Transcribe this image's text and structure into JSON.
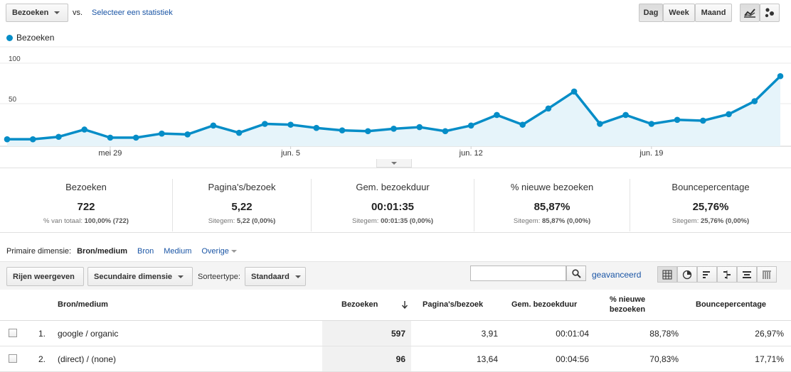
{
  "toolbar": {
    "metric_select": "Bezoeken",
    "vs_label": "vs.",
    "select_statistic": "Selecteer een statistiek",
    "granularity": [
      "Dag",
      "Week",
      "Maand"
    ],
    "active_granularity": "Dag",
    "chart_type_icons": [
      "line-chart-icon",
      "motion-chart-icon"
    ]
  },
  "chart": {
    "legend": "Bezoeken",
    "colors": {
      "line": "#058dc7",
      "fill": "#e6f4fa"
    }
  },
  "chart_data": {
    "type": "area",
    "series": [
      {
        "name": "Bezoeken",
        "values": [
          6,
          6,
          9,
          18,
          8,
          8,
          13,
          12,
          23,
          14,
          25,
          24,
          20,
          17,
          16,
          19,
          21,
          16,
          23,
          36,
          24,
          44,
          65,
          25,
          36,
          25,
          30,
          29,
          37,
          53,
          84
        ]
      }
    ],
    "x_tick_labels": [
      "mei 29",
      "jun. 5",
      "jun. 12",
      "jun. 19"
    ],
    "x_tick_positions": [
      4,
      11,
      18,
      25
    ],
    "y_tick_labels": [
      "100",
      "50"
    ],
    "ylim": [
      0,
      100
    ],
    "grid": true
  },
  "scorecards": [
    {
      "label": "Bezoeken",
      "value": "722",
      "sub_prefix": "% van totaal:",
      "sub_value": "100,00% (722)"
    },
    {
      "label": "Pagina's/bezoek",
      "value": "5,22",
      "sub_prefix": "Sitegem:",
      "sub_value": "5,22 (0,00%)"
    },
    {
      "label": "Gem. bezoekduur",
      "value": "00:01:35",
      "sub_prefix": "Sitegem:",
      "sub_value": "00:01:35 (0,00%)"
    },
    {
      "label": "% nieuwe bezoeken",
      "value": "85,87%",
      "sub_prefix": "Sitegem:",
      "sub_value": "85,87% (0,00%)"
    },
    {
      "label": "Bouncepercentage",
      "value": "25,76%",
      "sub_prefix": "Sitegem:",
      "sub_value": "25,76% (0,00%)"
    }
  ],
  "primary_dimension": {
    "label": "Primaire dimensie:",
    "active": "Bron/medium",
    "options": [
      "Bron",
      "Medium"
    ],
    "other": "Overige"
  },
  "table_toolbar": {
    "show_rows": "Rijen weergeven",
    "secondary_dimension": "Secundaire dimensie",
    "sort_type_label": "Sorteertype:",
    "sort_type_value": "Standaard",
    "search_placeholder": "",
    "advanced": "geavanceerd",
    "view_icons": [
      "data-table-icon",
      "pie-chart-icon",
      "performance-icon",
      "comparison-icon",
      "term-cloud-icon",
      "pivot-icon"
    ]
  },
  "table": {
    "headers": {
      "dimension": "Bron/medium",
      "visits": "Bezoeken",
      "pages_per_visit": "Pagina's/bezoek",
      "avg_duration": "Gem. bezoekduur",
      "new_visits_line1": "% nieuwe",
      "new_visits_line2": "bezoeken",
      "bounce": "Bouncepercentage"
    },
    "rows": [
      {
        "index": "1.",
        "source": "google / organic",
        "visits": "597",
        "pages": "3,91",
        "duration": "00:01:04",
        "new_visits": "88,78%",
        "bounce": "26,97%"
      },
      {
        "index": "2.",
        "source": "(direct) / (none)",
        "visits": "96",
        "pages": "13,64",
        "duration": "00:04:56",
        "new_visits": "70,83%",
        "bounce": "17,71%"
      }
    ]
  }
}
